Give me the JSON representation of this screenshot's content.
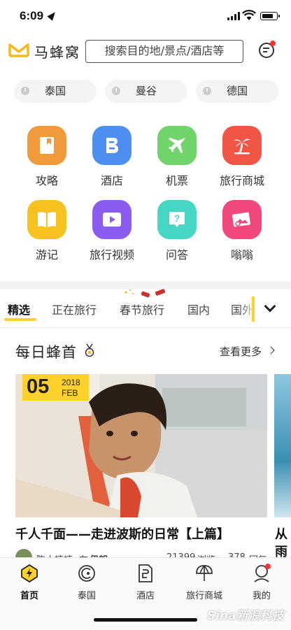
{
  "status_bar": {
    "time": "6:09"
  },
  "header": {
    "brand": "马蜂窝",
    "search_placeholder": "搜索目的地/景点/酒店等"
  },
  "weather_pills": [
    "泰国",
    "曼谷",
    "德国"
  ],
  "grid": [
    {
      "label": "攻略",
      "icon": "guide-book-icon",
      "color": "#f19a3c"
    },
    {
      "label": "酒店",
      "icon": "hotel-icon",
      "color": "#4d8ff1"
    },
    {
      "label": "机票",
      "icon": "airplane-icon",
      "color": "#6fd46a"
    },
    {
      "label": "旅行商城",
      "icon": "palm-tree-icon",
      "color": "#f05546"
    },
    {
      "label": "游记",
      "icon": "open-book-icon",
      "color": "#f7c21f"
    },
    {
      "label": "旅行视频",
      "icon": "play-icon",
      "color": "#8b5cf0"
    },
    {
      "label": "问答",
      "icon": "question-icon",
      "color": "#46d6c4"
    },
    {
      "label": "嗡嗡",
      "icon": "photo-icon",
      "color": "#f0487a"
    }
  ],
  "tabs": [
    "精选",
    "正在旅行",
    "春节旅行",
    "国内",
    "国外"
  ],
  "section": {
    "title": "每日蜂首",
    "more": "查看更多"
  },
  "card": {
    "day": "05",
    "year": "2018",
    "month": "FEB",
    "title": "千人千面——走进波斯的日常【上篇】",
    "author": "陈小蟀蟀",
    "at": "在",
    "place": "伊朗",
    "views": "21399",
    "views_label": "浏览",
    "replies": "378",
    "replies_label": "回复"
  },
  "card_next": {
    "title_line1": "从",
    "title_line2": "雨"
  },
  "tabbar": [
    {
      "label": "首页",
      "icon": "home-icon",
      "active": true
    },
    {
      "label": "泰国",
      "icon": "destination-icon",
      "active": false
    },
    {
      "label": "酒店",
      "icon": "hotel-doc-icon",
      "active": false
    },
    {
      "label": "旅行商城",
      "icon": "mall-icon",
      "active": false
    },
    {
      "label": "我的",
      "icon": "profile-icon",
      "active": false
    }
  ],
  "watermark": "Sina新浪科技",
  "colors": {
    "accent": "#ffd12a",
    "badge": "#ff3333"
  }
}
